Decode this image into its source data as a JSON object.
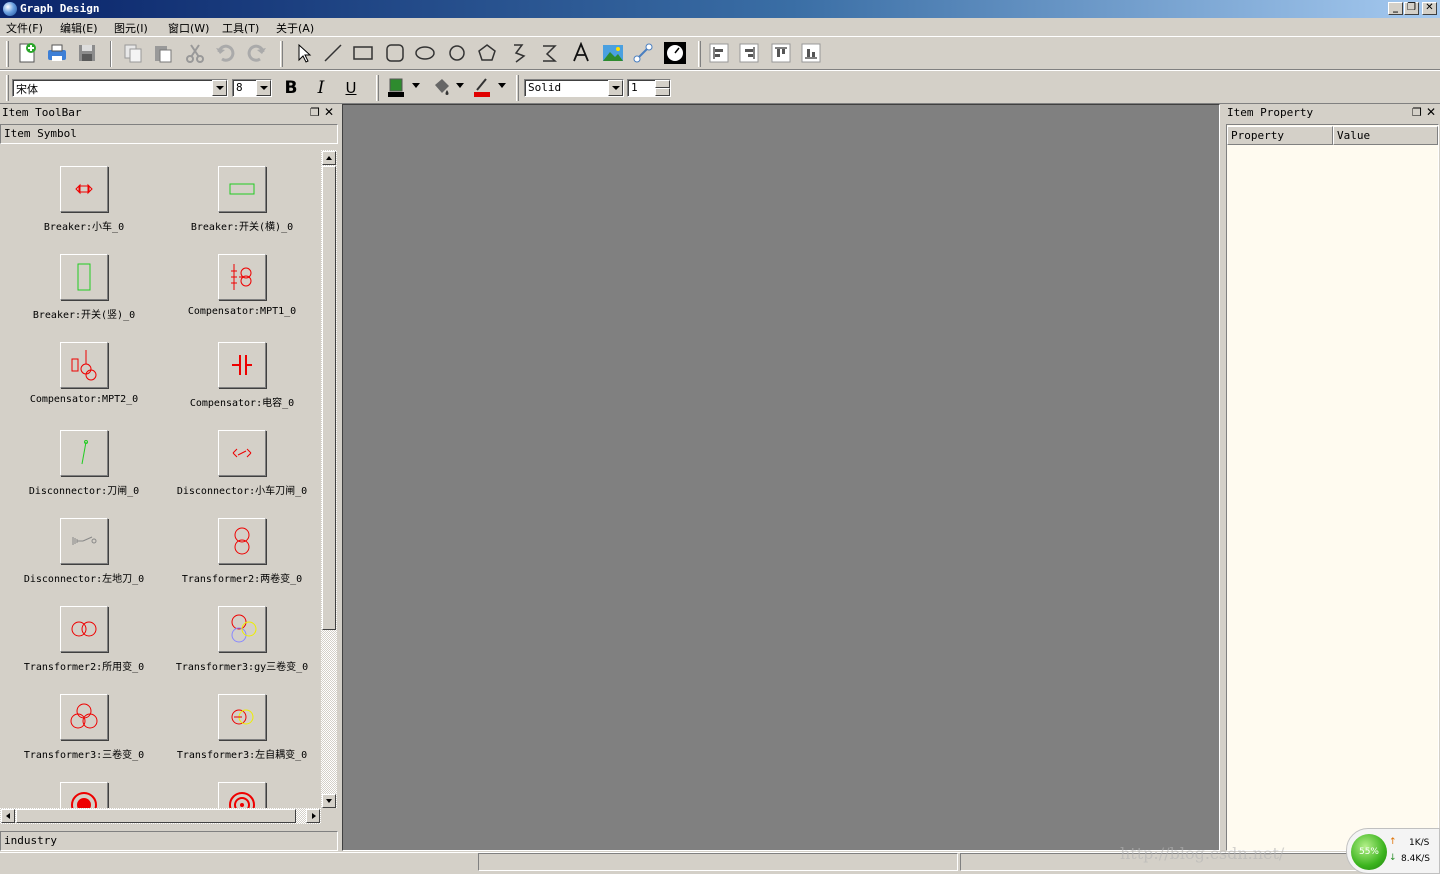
{
  "window": {
    "title": "Graph Design",
    "controls": {
      "minimize": "_",
      "restore": "❐",
      "close": "✕"
    }
  },
  "menu": [
    "文件(F)",
    "编辑(E)",
    "图元(I)",
    "窗口(W)",
    "工具(T)",
    "关于(A)"
  ],
  "format_toolbar": {
    "font": "宋体",
    "font_size": "8",
    "bold": "B",
    "italic": "I",
    "underline": "U",
    "line_style": "Solid",
    "line_width": "1",
    "fill_color": "#2e8b2e",
    "line_color": "#e00000"
  },
  "left_panel": {
    "title": "Item ToolBar",
    "tab": "Item Symbol",
    "category": "industry",
    "symbols": [
      "Breaker:小车_0",
      "Breaker:开关(横)_0",
      "Breaker:开关(竖)_0",
      "Compensator:MPT1_0",
      "Compensator:MPT2_0",
      "Compensator:电容_0",
      "Disconnector:刀闸_0",
      "Disconnector:小车刀闸_0",
      "Disconnector:左地刀_0",
      "Transformer2:两卷变_0",
      "Transformer2:所用变_0",
      "Transformer3:gy三卷变_0",
      "Transformer3:三卷变_0",
      "Transformer3:左自耦变_0"
    ]
  },
  "right_panel": {
    "title": "Item Property",
    "columns": [
      "Property",
      "Value"
    ]
  },
  "netwidget": {
    "percent": "55%",
    "up": "1K/S",
    "down": "8.4K/S"
  },
  "watermark": "http://blog.csdn.net/"
}
